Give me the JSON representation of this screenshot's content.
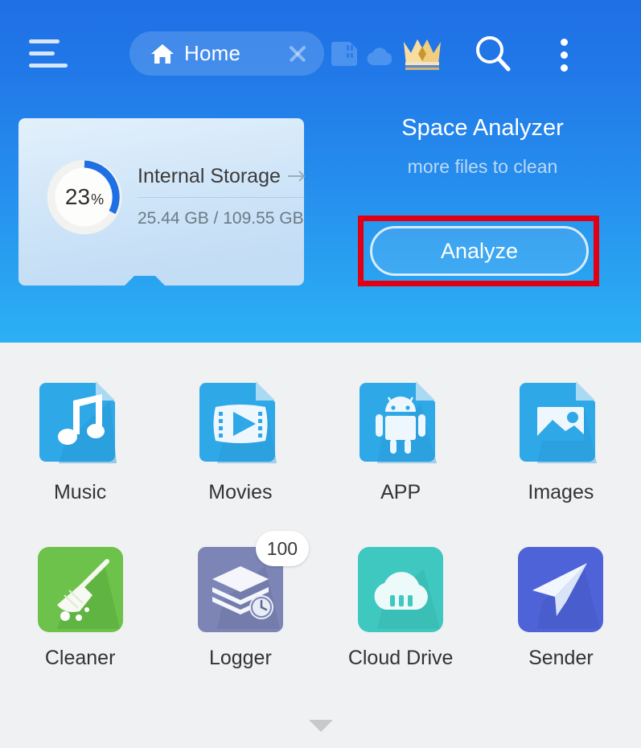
{
  "topbar": {
    "menu_icon": "hamburger-menu-icon",
    "tab": {
      "icon": "home-icon",
      "label": "Home",
      "close_icon": "close-icon"
    },
    "icons": [
      {
        "name": "sdcard-icon",
        "label": "SD Card"
      },
      {
        "name": "cloud-icon",
        "label": "Cloud"
      },
      {
        "name": "crown-icon",
        "label": "Premium"
      },
      {
        "name": "search-icon",
        "label": "Search"
      },
      {
        "name": "more-vertical-icon",
        "label": "More options"
      }
    ]
  },
  "storage_card": {
    "percent_value": "23",
    "percent_symbol": "%",
    "percent_number": 23,
    "title": "Internal Storage",
    "arrow_icon": "arrow-right-icon",
    "usage": "25.44 GB / 109.55 GB",
    "used_gb": "25.44 GB",
    "total_gb": "109.55 GB"
  },
  "analyzer": {
    "title": "Space Analyzer",
    "subtitle": "more files to clean",
    "button_label": "Analyze",
    "highlight_color": "#e00014"
  },
  "grid": {
    "rows": [
      [
        {
          "label": "Music",
          "icon": "music-file-icon",
          "color": "#2fa8e8"
        },
        {
          "label": "Movies",
          "icon": "movie-file-icon",
          "color": "#2fa8e8"
        },
        {
          "label": "APP",
          "icon": "android-file-icon",
          "color": "#2fa8e8"
        },
        {
          "label": "Images",
          "icon": "image-file-icon",
          "color": "#2fa8e8"
        }
      ],
      [
        {
          "label": "Cleaner",
          "icon": "broom-icon",
          "color": "#6cc24a"
        },
        {
          "label": "Logger",
          "icon": "log-stack-icon",
          "color": "#7c85b5",
          "badge": "100"
        },
        {
          "label": "Cloud Drive",
          "icon": "cloud-drive-icon",
          "color": "#3fc8c0"
        },
        {
          "label": "Sender",
          "icon": "paper-plane-icon",
          "color": "#4e63d8"
        }
      ]
    ]
  },
  "footer": {
    "pull_icon": "chevron-down-icon"
  },
  "colors": {
    "hero_top": "#1f6fe5",
    "hero_bottom": "#2cb0f4",
    "page_bg": "#f0f1f2",
    "card_bg": "#cfe5f8",
    "ring_accent": "#1f6fe5",
    "highlight": "#e00014"
  }
}
